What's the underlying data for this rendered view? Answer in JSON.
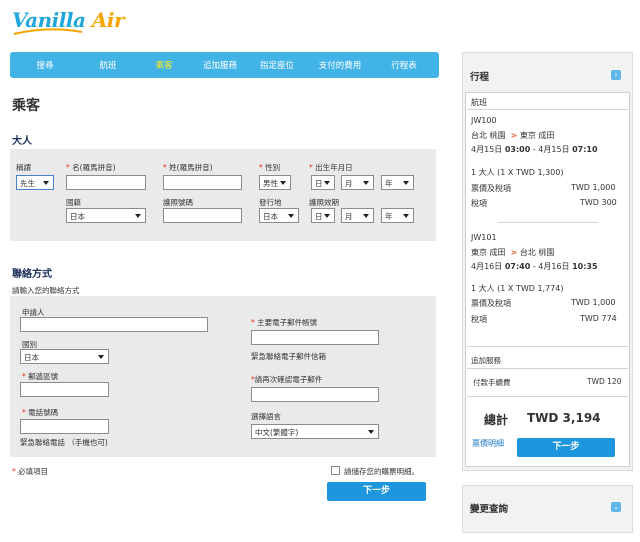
{
  "brand": {
    "logo_text_main": "Vanilla",
    "logo_text_accent": "Air",
    "color_blue": "#1fa7dc",
    "color_gold": "#f5a400"
  },
  "nav": {
    "items": [
      "搜尋",
      "航班",
      "乘客",
      "追加服務",
      "指定座位",
      "支付的費用",
      "行程表"
    ],
    "active_index": 2
  },
  "page_title": "乘客",
  "adult": {
    "heading": "大人",
    "title_label": "稱謂",
    "title_value": "先生",
    "first_name_label": "名(羅馬拼音)",
    "last_name_label": "姓(羅馬拼音)",
    "gender_label": "性別",
    "gender_value": "男性",
    "dob_label": "出生年月日",
    "day_value": "日",
    "month_value": "月",
    "year_value": "年",
    "nationality_label": "國籍",
    "nationality_value": "日本",
    "passport_label": "護照號碼",
    "issuing_label": "發行地",
    "issuing_value": "日本",
    "expiry_label": "護照效期",
    "exp_day": "日",
    "exp_month": "月",
    "exp_year": "年"
  },
  "contact": {
    "heading": "聯絡方式",
    "subtitle": "請輸入您的聯絡方式",
    "applicant_label": "申請人",
    "email_label": "主要電子郵件帳號",
    "country_label": "國別",
    "country_value": "日本",
    "email_note": "緊急聯絡電子郵件信箱",
    "postal_label": "郵遞區號",
    "email_confirm_label": "請再次確認電子郵件",
    "phone_label": "電話號碼",
    "language_label": "選擇語言",
    "language_value": "中文(繁體字)",
    "phone_note": "緊急聯絡電話 （手機也可)"
  },
  "form_footer": {
    "required_note": "必填項目",
    "save_label": "請儲存您的購票明細。",
    "next_label": "下一步"
  },
  "itinerary": {
    "title": "行程",
    "section_label": "航班",
    "flights": [
      {
        "number": "JW100",
        "from": "台北 桃園",
        "to": "東京 成田",
        "date_prefix": "4月15日",
        "depart": "03:00",
        "date_sep": "- 4月15日",
        "arrive": "07:10",
        "pax_line": "1 大人 (1 X TWD 1,300)",
        "fare_label": "票價及稅項",
        "fare_value": "TWD 1,000",
        "tax_label": "稅項",
        "tax_value": "TWD 300"
      },
      {
        "number": "JW101",
        "from": "東京 成田",
        "to": "台北 桃園",
        "date_prefix": "4月16日",
        "depart": "07:40",
        "date_sep": "- 4月16日",
        "arrive": "10:35",
        "pax_line": "1 大人 (1 X TWD 1,774)",
        "fare_label": "票價及稅項",
        "fare_value": "TWD 1,000",
        "tax_label": "稅項",
        "tax_value": "TWD 774"
      }
    ],
    "extras_label": "追加服務",
    "fee_label": "付款手續費",
    "fee_value": "TWD 120",
    "total_label": "總計",
    "total_value": "TWD 3,194",
    "details_link": "票價明細",
    "next_label": "下一步"
  },
  "change_query": {
    "title": "變更查詢"
  }
}
